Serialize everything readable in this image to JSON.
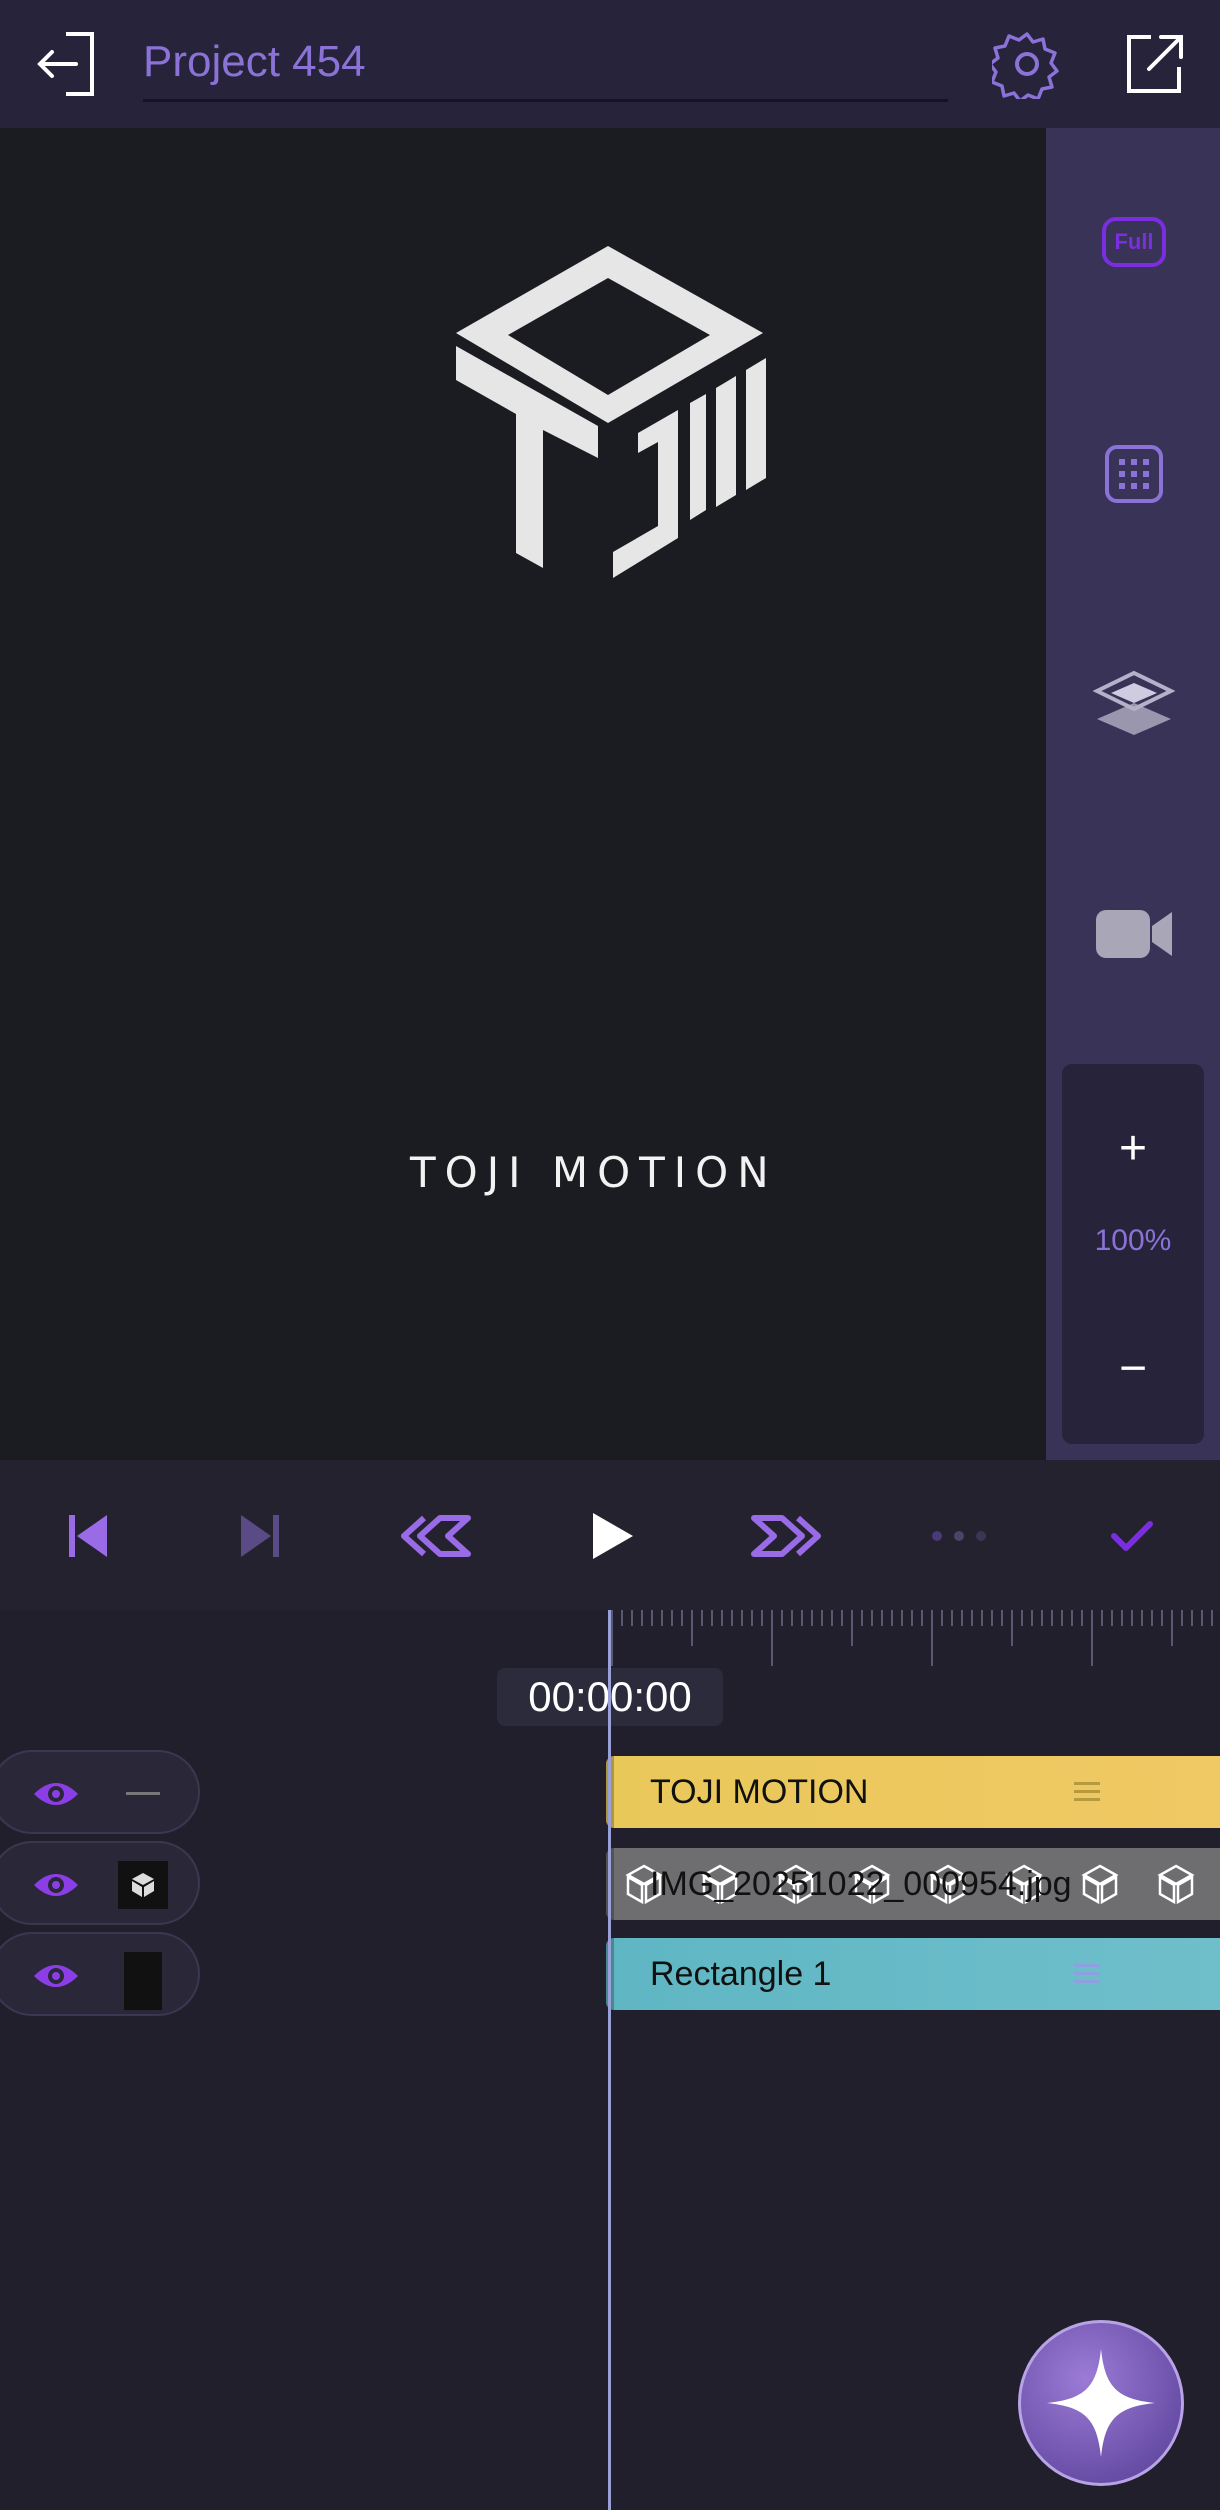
{
  "header": {
    "project_title": "Project 454"
  },
  "preview": {
    "brand_text": "TOJI MOTION"
  },
  "sidepanel": {
    "full_label": "Full",
    "zoom_plus": "+",
    "zoom_level": "100%",
    "zoom_minus": "−"
  },
  "timeline": {
    "timecode": "00:00:00",
    "tracks": [
      {
        "label": "TOJI MOTION",
        "color": "#efc75e"
      },
      {
        "label": "IMG_20251022_000954.jpg",
        "color": "#6e6e70"
      },
      {
        "label": "Rectangle 1",
        "color": "#66bbc7"
      }
    ]
  },
  "colors": {
    "accent": "#8b5cf6",
    "top_bar": "#26233a",
    "side_panel": "#3a3358"
  }
}
